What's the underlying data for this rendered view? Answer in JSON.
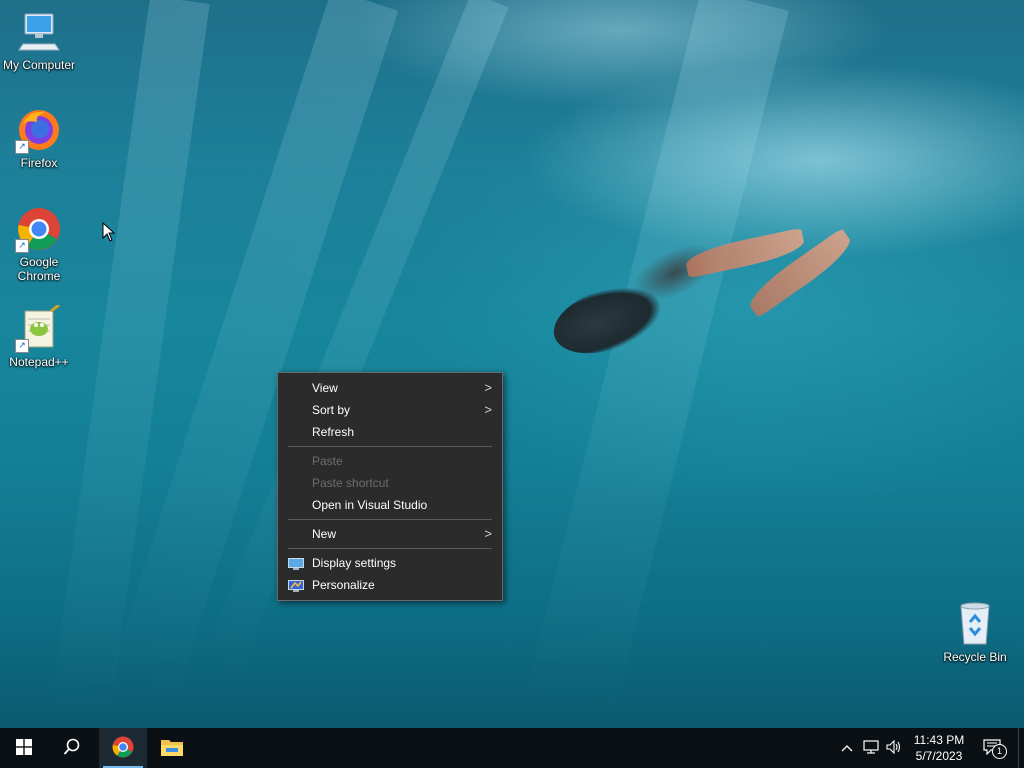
{
  "desktop": {
    "icons": [
      {
        "label": "My Computer",
        "icon": "computer-icon"
      },
      {
        "label": "Firefox",
        "icon": "firefox-icon"
      },
      {
        "label": "Google Chrome",
        "icon": "chrome-icon"
      },
      {
        "label": "Notepad++",
        "icon": "notepadpp-icon"
      },
      {
        "label": "Recycle Bin",
        "icon": "recycle-bin-icon"
      }
    ]
  },
  "context_menu": {
    "items": [
      {
        "label": "View",
        "submenu": true,
        "enabled": true
      },
      {
        "label": "Sort by",
        "submenu": true,
        "enabled": true
      },
      {
        "label": "Refresh",
        "submenu": false,
        "enabled": true
      },
      {
        "label": "Paste",
        "submenu": false,
        "enabled": false
      },
      {
        "label": "Paste shortcut",
        "submenu": false,
        "enabled": false
      },
      {
        "label": "Open in Visual Studio",
        "submenu": false,
        "enabled": true
      },
      {
        "label": "New",
        "submenu": true,
        "enabled": true
      },
      {
        "label": "Display settings",
        "submenu": false,
        "enabled": true,
        "icon": "display-settings-icon"
      },
      {
        "label": "Personalize",
        "submenu": false,
        "enabled": true,
        "icon": "personalize-icon"
      }
    ],
    "submenu_arrow": ">"
  },
  "taskbar": {
    "clock_time": "11:43 PM",
    "clock_date": "5/7/2023",
    "notification_count": "1",
    "accent_color": "#76b9ed"
  }
}
